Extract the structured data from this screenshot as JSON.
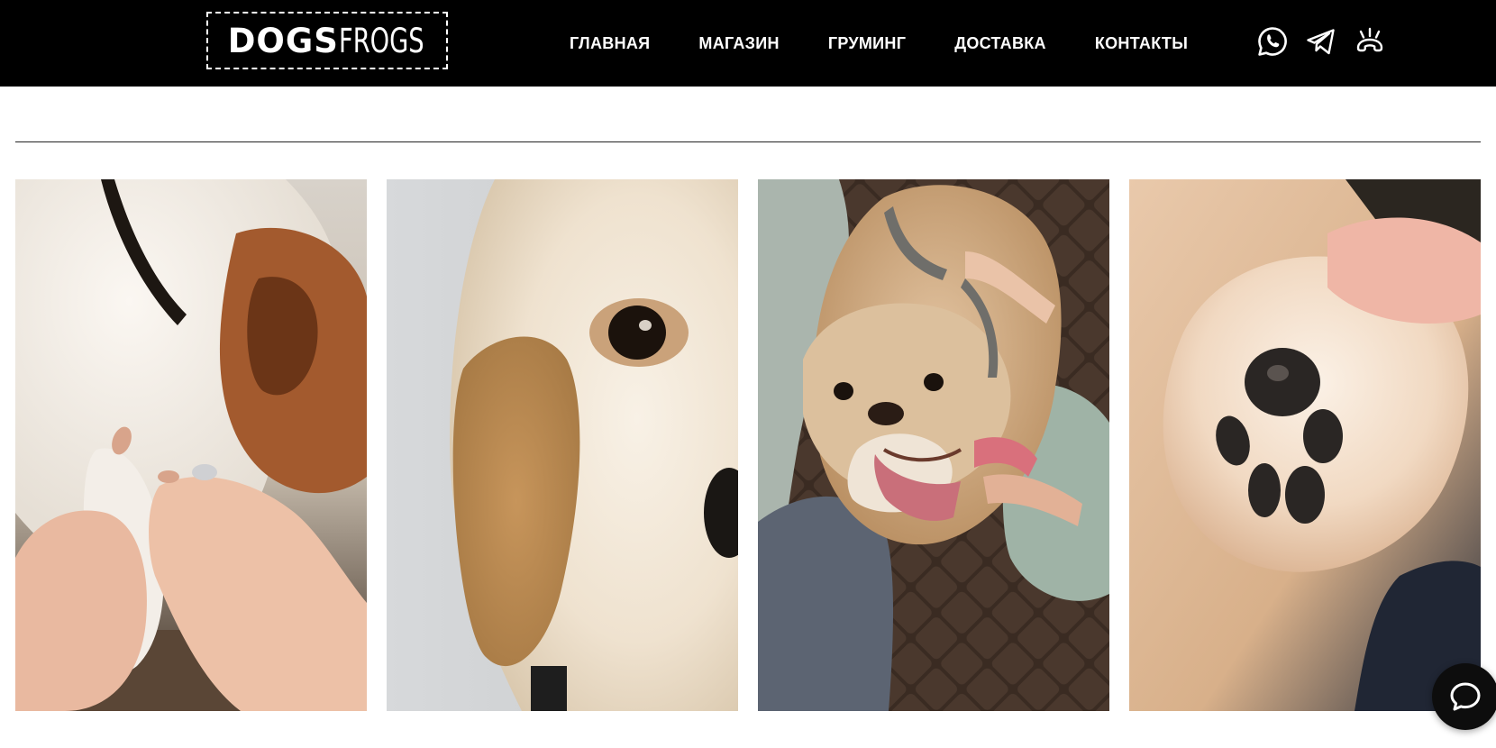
{
  "header": {
    "logo": {
      "part1": "DOGS",
      "part2": "FROGS"
    },
    "nav": [
      {
        "label": "ГЛАВНАЯ"
      },
      {
        "label": "МАГАЗИН"
      },
      {
        "label": "ГРУМИНГ"
      },
      {
        "label": "ДОСТАВКА"
      },
      {
        "label": "КОНТАКТЫ"
      }
    ],
    "social_icons": [
      "whatsapp-icon",
      "telegram-icon",
      "phone-icon"
    ]
  },
  "gallery": {
    "photos": [
      {
        "subject": "groomer-holding-dog-paw"
      },
      {
        "subject": "fluffy-dog-eye-closeup"
      },
      {
        "subject": "bulldog-with-tongue-out"
      },
      {
        "subject": "dog-paw-pad-closeup"
      }
    ]
  },
  "chat": {
    "icon": "chat-bubble-icon"
  },
  "colors": {
    "header_bg": "#000000",
    "text_on_header": "#ffffff",
    "divider": "#222222",
    "chat_bg": "#0d0d0d"
  }
}
